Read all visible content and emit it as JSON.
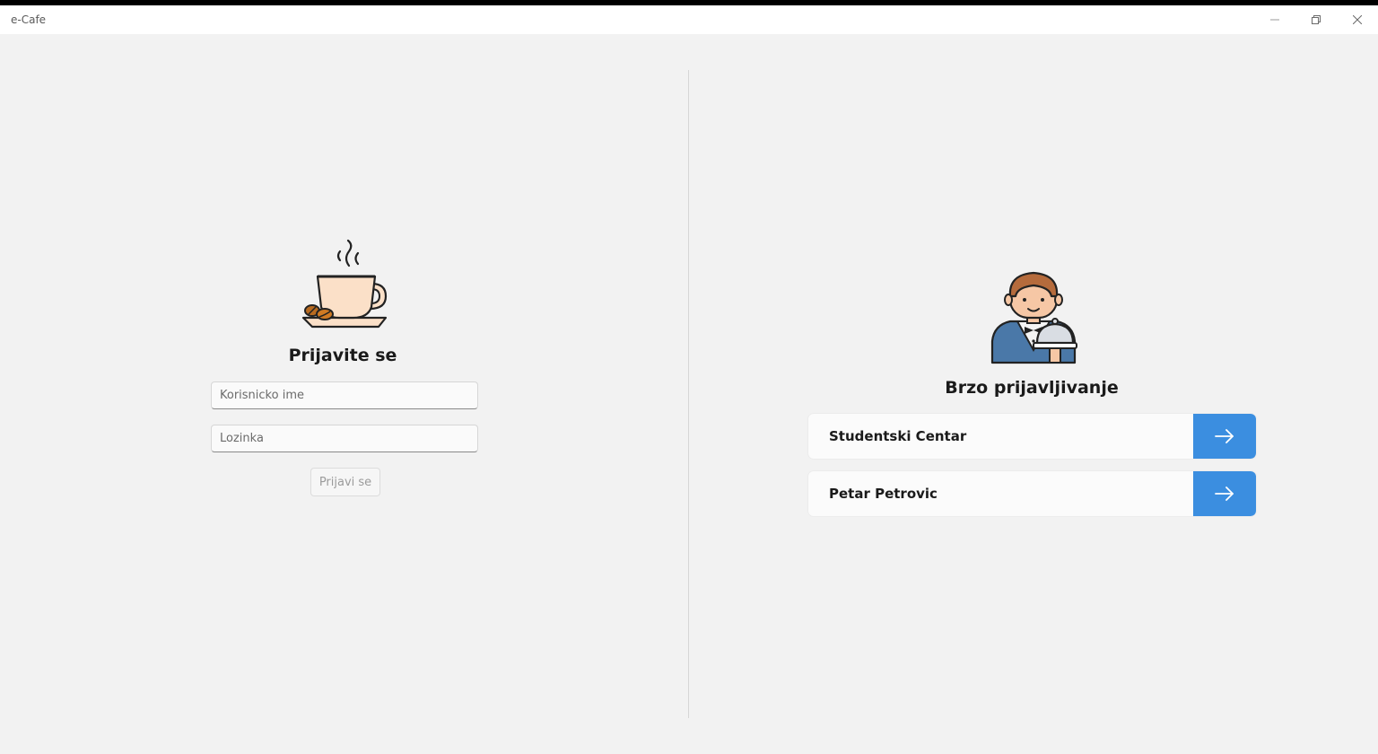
{
  "window": {
    "title": "e-Cafe",
    "controls": [
      "minimize-icon",
      "restore-icon",
      "close-icon"
    ]
  },
  "login": {
    "icon": "coffee-cup-icon",
    "title": "Prijavite se",
    "username_placeholder": "Korisnicko ime",
    "password_placeholder": "Lozinka",
    "submit_label": "Prijavi se"
  },
  "quick_login": {
    "icon": "waiter-icon",
    "title": "Brzo prijavljivanje",
    "users": [
      {
        "name": "Studentski Centar",
        "action_icon": "arrow-right-icon"
      },
      {
        "name": "Petar Petrovic",
        "action_icon": "arrow-right-icon"
      }
    ]
  },
  "colors": {
    "accent": "#3b8ee0",
    "background": "#f2f2f2",
    "titlebar": "#ffffff"
  }
}
